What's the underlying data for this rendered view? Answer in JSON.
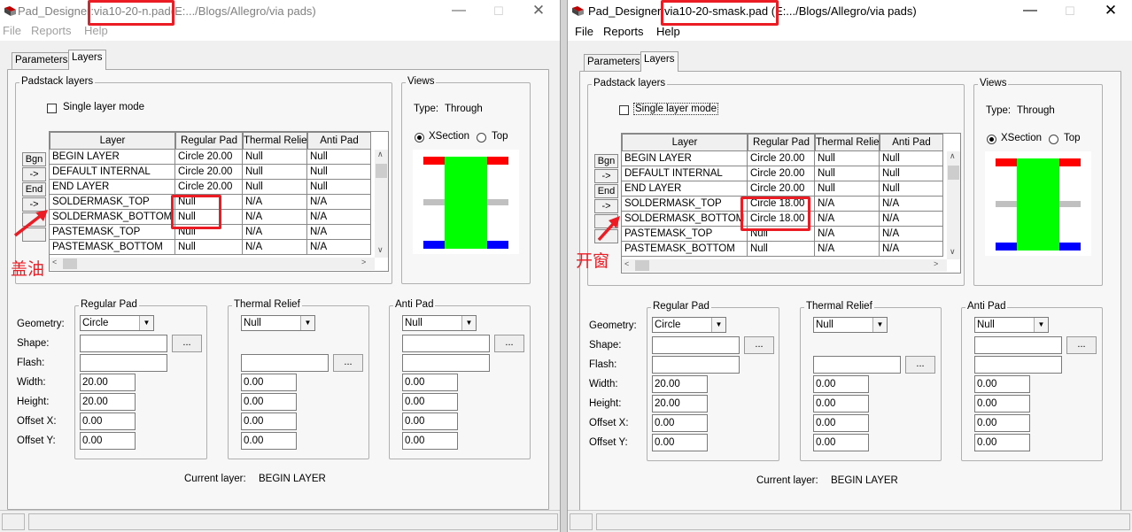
{
  "colors": {
    "annotation": "#ec1c24",
    "pad_green": "#00ff00",
    "top_red": "#ff0000",
    "bottom_blue": "#0000ff",
    "internal_gray": "#c0c0c0"
  },
  "left": {
    "title": {
      "app": "Pad_Designer:",
      "file": "via10-20-n.pad",
      "path": "(E:.../Blogs/Allegro/via pads)"
    },
    "menu": [
      "File",
      "Reports",
      "Help"
    ],
    "tabs": [
      "Parameters",
      "Layers"
    ],
    "padstack_label": "Padstack layers",
    "single_layer_mode": "Single layer mode",
    "columns": [
      "Layer",
      "Regular Pad",
      "Thermal Relief",
      "Anti Pad"
    ],
    "row_buttons": [
      "Bgn",
      "->",
      "End",
      "->",
      "",
      ""
    ],
    "rows": [
      [
        "BEGIN LAYER",
        "Circle 20.00",
        "Null",
        "Null"
      ],
      [
        "DEFAULT INTERNAL",
        "Circle 20.00",
        "Null",
        "Null"
      ],
      [
        "END LAYER",
        "Circle 20.00",
        "Null",
        "Null"
      ],
      [
        "SOLDERMASK_TOP",
        "Null",
        "N/A",
        "N/A"
      ],
      [
        "SOLDERMASK_BOTTOM",
        "Null",
        "N/A",
        "N/A"
      ],
      [
        "PASTEMASK_TOP",
        "Null",
        "N/A",
        "N/A"
      ],
      [
        "PASTEMASK_BOTTOM",
        "Null",
        "N/A",
        "N/A"
      ]
    ],
    "views": {
      "label": "Views",
      "type_label": "Type:",
      "type_value": "Through",
      "xsection": "XSection",
      "top": "Top"
    },
    "annotation": "盖油",
    "regular_pad": {
      "label": "Regular Pad",
      "geometry": "Circle",
      "width": "20.00",
      "height": "20.00",
      "offset_x": "0.00",
      "offset_y": "0.00"
    },
    "thermal_relief": {
      "label": "Thermal Relief",
      "geometry": "Null",
      "width": "0.00",
      "height": "0.00",
      "offset_x": "0.00",
      "offset_y": "0.00"
    },
    "anti_pad": {
      "label": "Anti Pad",
      "geometry": "Null",
      "width": "0.00",
      "height": "0.00",
      "offset_x": "0.00",
      "offset_y": "0.00"
    },
    "field_labels": [
      "Geometry:",
      "Shape:",
      "Flash:",
      "Width:",
      "Height:",
      "Offset X:",
      "Offset Y:"
    ],
    "current_layer_label": "Current layer:",
    "current_layer": "BEGIN LAYER",
    "dots_label": "..."
  },
  "right": {
    "title": {
      "app": "Pad_Designer:",
      "file": "via10-20-smask.pad",
      "path": "(E:.../Blogs/Allegro/via pads)"
    },
    "menu": [
      "File",
      "Reports",
      "Help"
    ],
    "tabs": [
      "Parameters",
      "Layers"
    ],
    "padstack_label": "Padstack layers",
    "single_layer_mode": "Single layer mode",
    "columns": [
      "Layer",
      "Regular Pad",
      "Thermal Relief",
      "Anti Pad"
    ],
    "row_buttons": [
      "Bgn",
      "->",
      "End",
      "->",
      "",
      ""
    ],
    "rows": [
      [
        "BEGIN LAYER",
        "Circle 20.00",
        "Null",
        "Null"
      ],
      [
        "DEFAULT INTERNAL",
        "Circle 20.00",
        "Null",
        "Null"
      ],
      [
        "END LAYER",
        "Circle 20.00",
        "Null",
        "Null"
      ],
      [
        "SOLDERMASK_TOP",
        "Circle 18.00",
        "N/A",
        "N/A"
      ],
      [
        "SOLDERMASK_BOTTOM",
        "Circle 18.00",
        "N/A",
        "N/A"
      ],
      [
        "PASTEMASK_TOP",
        "Null",
        "N/A",
        "N/A"
      ],
      [
        "PASTEMASK_BOTTOM",
        "Null",
        "N/A",
        "N/A"
      ]
    ],
    "views": {
      "label": "Views",
      "type_label": "Type:",
      "type_value": "Through",
      "xsection": "XSection",
      "top": "Top"
    },
    "annotation": "开窗",
    "regular_pad": {
      "label": "Regular Pad",
      "geometry": "Circle",
      "width": "20.00",
      "height": "20.00",
      "offset_x": "0.00",
      "offset_y": "0.00"
    },
    "thermal_relief": {
      "label": "Thermal Relief",
      "geometry": "Null",
      "width": "0.00",
      "height": "0.00",
      "offset_x": "0.00",
      "offset_y": "0.00"
    },
    "anti_pad": {
      "label": "Anti Pad",
      "geometry": "Null",
      "width": "0.00",
      "height": "0.00",
      "offset_x": "0.00",
      "offset_y": "0.00"
    },
    "field_labels": [
      "Geometry:",
      "Shape:",
      "Flash:",
      "Width:",
      "Height:",
      "Offset X:",
      "Offset Y:"
    ],
    "current_layer_label": "Current layer:",
    "current_layer": "BEGIN LAYER",
    "dots_label": "..."
  }
}
